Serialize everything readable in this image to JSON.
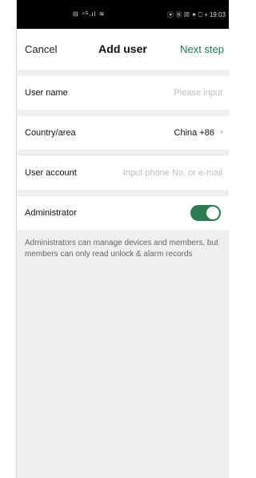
{
  "status_bar": {
    "left": "⊟ ⁴ᴳ.ıl ≋",
    "right": "⦿ Ⓝ ☒ ✶ ⎕ + 19:03"
  },
  "nav": {
    "cancel": "Cancel",
    "title": "Add user",
    "next": "Next step",
    "accent_color": "#1f7a55"
  },
  "form": {
    "user_name": {
      "label": "User name",
      "placeholder": "Please input",
      "value": ""
    },
    "country": {
      "label": "Country/area",
      "value": "China +86",
      "chevron": "›"
    },
    "user_account": {
      "label": "User account",
      "placeholder": "Input phone No. or e-mail",
      "value": ""
    },
    "administrator": {
      "label": "Administrator",
      "enabled": true,
      "toggle_color": "#2b7a52"
    }
  },
  "note": "Administrators can manage devices and members, but members can only read unlock & alarm records"
}
